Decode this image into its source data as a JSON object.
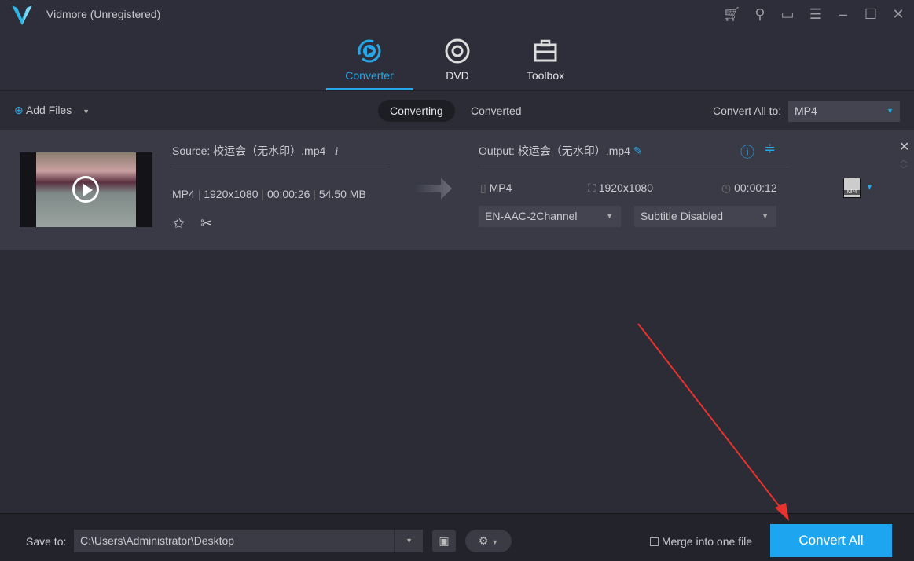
{
  "app": {
    "title": "Vidmore (Unregistered)"
  },
  "window_controls": [
    "cart-icon",
    "key-icon",
    "feedback-icon",
    "menu-icon",
    "minimize-icon",
    "maximize-icon",
    "close-icon"
  ],
  "nav": {
    "tabs": [
      {
        "label": "Converter",
        "active": true
      },
      {
        "label": "DVD"
      },
      {
        "label": "Toolbox"
      }
    ]
  },
  "toolbar": {
    "add_files": "Add Files",
    "converting": "Converting",
    "converted": "Converted",
    "convert_all_to_label": "Convert All to:",
    "format": "MP4"
  },
  "file": {
    "source_label": "Source:",
    "source_name": "校运会（无水印）.mp4",
    "format": "MP4",
    "resolution": "1920x1080",
    "duration": "00:00:26",
    "size": "54.50 MB",
    "output_label": "Output:",
    "output_name": "校运会（无水印）.mp4",
    "out_format": "MP4",
    "out_resolution": "1920x1080",
    "out_duration": "00:00:12",
    "audio": "EN-AAC-2Channel",
    "subtitle": "Subtitle Disabled",
    "format_badge": "MP4"
  },
  "bottom": {
    "save_to_label": "Save to:",
    "save_path": "C:\\Users\\Administrator\\Desktop",
    "merge_label": "Merge into one file",
    "convert_all": "Convert All"
  },
  "colors": {
    "accent": "#1ea5ef",
    "annotation": "#e8322e"
  }
}
